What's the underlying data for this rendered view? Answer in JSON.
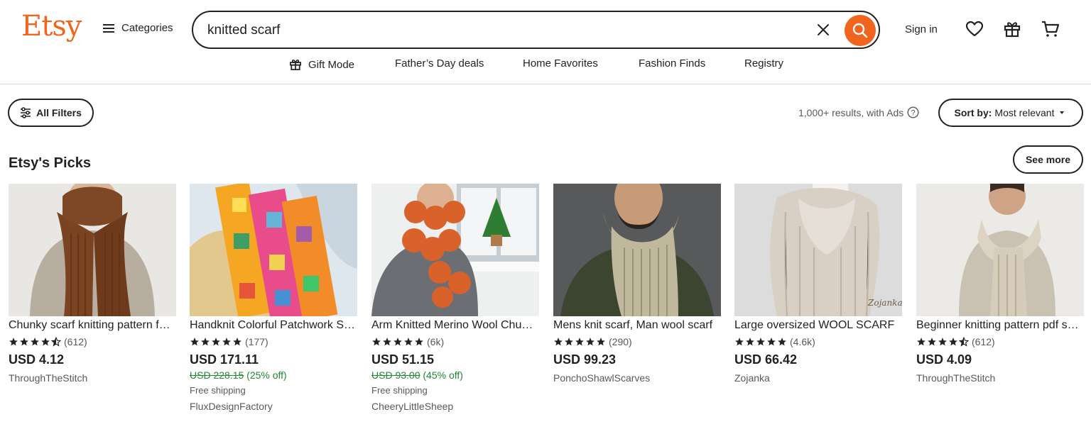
{
  "header": {
    "logo": "Etsy",
    "categories_label": "Categories",
    "search_value": "knitted scarf",
    "signin_label": "Sign in",
    "accent": "#f1641e"
  },
  "subnav": [
    {
      "label": "Gift Mode",
      "icon": "gift-icon"
    },
    {
      "label": "Father’s Day deals"
    },
    {
      "label": "Home Favorites"
    },
    {
      "label": "Fashion Finds"
    },
    {
      "label": "Registry"
    }
  ],
  "toolbar": {
    "filters_label": "All Filters",
    "results_text": "1,000+ results, with Ads",
    "sort_prefix": "Sort by:",
    "sort_value": "Most relevant"
  },
  "picks": {
    "title": "Etsy's Picks",
    "see_more": "See more",
    "items": [
      {
        "title": "Chunky scarf knitting pattern for beginners",
        "rating": 4.5,
        "reviews": "(612)",
        "price": "USD 4.12",
        "original_price": "",
        "discount": "",
        "shipping": "",
        "shop": "ThroughTheStitch"
      },
      {
        "title": "Handknit Colorful Patchwork Scarf",
        "rating": 5,
        "reviews": "(177)",
        "price": "USD 171.11",
        "original_price": "USD 228.15",
        "discount": "(25% off)",
        "shipping": "Free shipping",
        "shop": "FluxDesignFactory"
      },
      {
        "title": "Arm Knitted Merino Wool Chunky Scarf",
        "rating": 5,
        "reviews": "(6k)",
        "price": "USD 51.15",
        "original_price": "USD 93.00",
        "discount": "(45% off)",
        "shipping": "Free shipping",
        "shop": "CheeryLittleSheep"
      },
      {
        "title": "Mens knit scarf, Man wool scarf",
        "rating": 5,
        "reviews": "(290)",
        "price": "USD 99.23",
        "original_price": "",
        "discount": "",
        "shipping": "",
        "shop": "PonchoShawlScarves"
      },
      {
        "title": "Large oversized WOOL SCARF",
        "rating": 5,
        "reviews": "(4.6k)",
        "price": "USD 66.42",
        "original_price": "",
        "discount": "",
        "shipping": "",
        "shop": "Zojanka"
      },
      {
        "title": "Beginner knitting pattern pdf scarf",
        "rating": 4.5,
        "reviews": "(612)",
        "price": "USD 4.09",
        "original_price": "",
        "discount": "",
        "shipping": "",
        "shop": "ThroughTheStitch"
      }
    ]
  }
}
